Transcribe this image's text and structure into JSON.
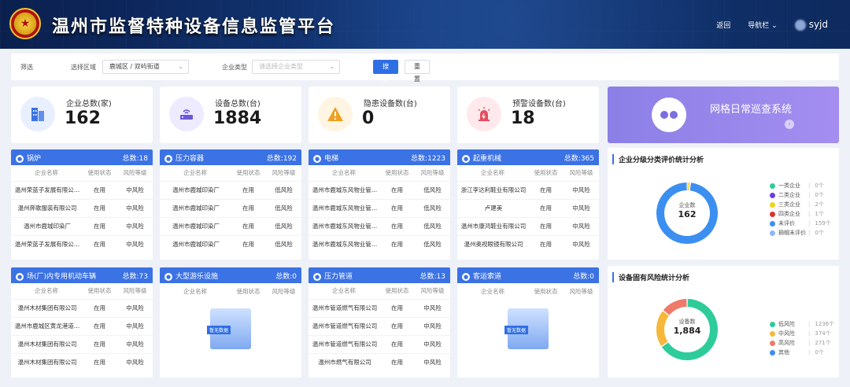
{
  "header": {
    "title": "温州市监督特种设备信息监管平台",
    "nav": [
      "返回",
      "导航栏"
    ],
    "user": "syjd"
  },
  "filter": {
    "label": "筛选",
    "region_label": "选择区域",
    "region_value": "鹿城区 / 双屿街道",
    "type_label": "企业类型",
    "type_placeholder": "请选择企业类型",
    "search": "搜索",
    "reset": "重置"
  },
  "stats": [
    {
      "label": "企业总数(家)",
      "value": "162",
      "color": "#3b72e4",
      "icon": "building-icon"
    },
    {
      "label": "设备总数(台)",
      "value": "1884",
      "color": "#6a5ad6",
      "icon": "router-icon"
    },
    {
      "label": "隐患设备数(台)",
      "value": "0",
      "color": "#f0a020",
      "icon": "warning-icon"
    },
    {
      "label": "预警设备数(台)",
      "value": "18",
      "color": "#e84a5f",
      "icon": "siren-icon"
    }
  ],
  "banner": {
    "text": "网格日常巡查系统"
  },
  "columns": [
    "企业名称",
    "使用状态",
    "风险等级"
  ],
  "total_label": "总数",
  "panels": [
    {
      "title": "锅炉",
      "total": "18",
      "rows": [
        [
          "温州荣蓝子发展有限公…",
          "在用",
          "中风险"
        ],
        [
          "温州奔歌服装有限公司",
          "在用",
          "中风险"
        ],
        [
          "温州市鹿城印染厂",
          "在用",
          "中风险"
        ],
        [
          "温州荣蓝子发展有限公…",
          "在用",
          "中风险"
        ]
      ]
    },
    {
      "title": "压力容器",
      "total": "192",
      "rows": [
        [
          "温州市鹿城印染厂",
          "在用",
          "低风险"
        ],
        [
          "温州市鹿城印染厂",
          "在用",
          "低风险"
        ],
        [
          "温州市鹿城印染厂",
          "在用",
          "低风险"
        ],
        [
          "温州市鹿城印染厂",
          "在用",
          "低风险"
        ]
      ]
    },
    {
      "title": "电梯",
      "total": "1223",
      "rows": [
        [
          "温州市鹿城东风物业管…",
          "在用",
          "低风险"
        ],
        [
          "温州市鹿城东风物业管…",
          "在用",
          "低风险"
        ],
        [
          "温州市鹿城东风物业管…",
          "在用",
          "低风险"
        ],
        [
          "温州市鹿城东风物业管…",
          "在用",
          "低风险"
        ]
      ]
    },
    {
      "title": "起重机械",
      "total": "365",
      "rows": [
        [
          "浙江李达利鞋业有限公司",
          "在用",
          "中风险"
        ],
        [
          "卢建美",
          "在用",
          "中风险"
        ],
        [
          "温州市康鸿鞋业有限公司",
          "在用",
          "中风险"
        ],
        [
          "温州奥视眼镜有限公司",
          "在用",
          "中风险"
        ]
      ]
    },
    {
      "title": "场(厂)内专用机动车辆",
      "total": "73",
      "rows": [
        [
          "温州木材集团有限公司",
          "在用",
          "中风险"
        ],
        [
          "温州市鹿城区黄龙港道…",
          "在用",
          "中风险"
        ],
        [
          "温州木材集团有限公司",
          "在用",
          "中风险"
        ],
        [
          "温州木材集团有限公司",
          "在用",
          "中风险"
        ]
      ]
    },
    {
      "title": "大型游乐设施",
      "total": "0",
      "rows": []
    },
    {
      "title": "压力管道",
      "total": "13",
      "rows": [
        [
          "温州市管道燃气有限公司",
          "在用",
          "中风险"
        ],
        [
          "温州市管道燃气有限公司",
          "在用",
          "中风险"
        ],
        [
          "温州市管道燃气有限公司",
          "在用",
          "中风险"
        ],
        [
          "温州市燃气有限公司",
          "在用",
          "中风险"
        ]
      ]
    },
    {
      "title": "客运索道",
      "total": "0",
      "rows": []
    }
  ],
  "empty_text": "暂无数据",
  "analysis1": {
    "title": "企业分级分类评价统计分析",
    "center_label": "企业数",
    "center_value": "162",
    "legend": [
      {
        "name": "一类企业",
        "value": "0个",
        "color": "#2ecc9a"
      },
      {
        "name": "二类企业",
        "value": "0个",
        "color": "#6a3de8"
      },
      {
        "name": "三类企业",
        "value": "2个",
        "color": "#f1d21a"
      },
      {
        "name": "四类企业",
        "value": "1个",
        "color": "#e03030"
      },
      {
        "name": "未评价",
        "value": "159个",
        "color": "#3b8ff0"
      },
      {
        "name": "摘帽未评价",
        "value": "0个",
        "color": "#8fb6f5"
      }
    ]
  },
  "analysis2": {
    "title": "设备固有风险统计分析",
    "center_label": "设备数",
    "center_value": "1,884",
    "legend": [
      {
        "name": "低风险",
        "value": "1236个",
        "color": "#2ecc9a"
      },
      {
        "name": "中风险",
        "value": "374个",
        "color": "#f5b83a"
      },
      {
        "name": "高风险",
        "value": "271个",
        "color": "#f07a6a"
      },
      {
        "name": "其他",
        "value": "0个",
        "color": "#3b8ff0"
      }
    ]
  }
}
